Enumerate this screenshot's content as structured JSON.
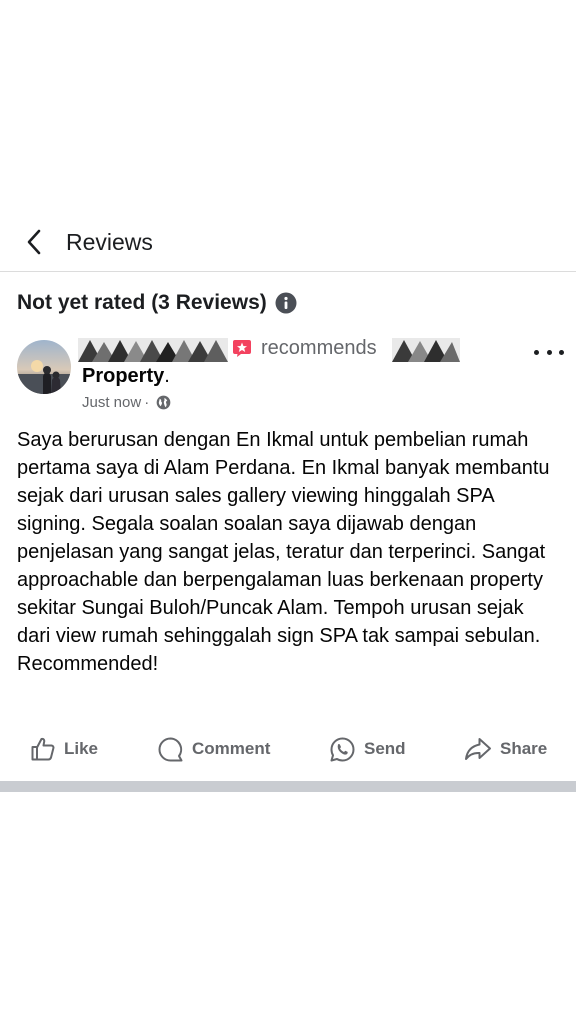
{
  "header": {
    "title": "Reviews",
    "back_icon": "chevron-left-icon"
  },
  "rating": {
    "text": "Not yet rated (3 Reviews)",
    "info_icon": "info-icon"
  },
  "post": {
    "recommends_label": "recommends",
    "page_name": "Property",
    "page_name_suffix": ".",
    "timestamp": "Just now",
    "separator": "·",
    "privacy_icon": "globe-icon",
    "badge_icon": "recommend-badge-icon",
    "badge_color": "#f3425f",
    "body": "Saya berurusan dengan En Ikmal untuk pembelian rumah pertama saya di Alam Perdana. En Ikmal banyak membantu sejak dari urusan sales gallery viewing hinggalah SPA signing. Segala soalan soalan saya dijawab dengan penjelasan yang sangat jelas, teratur dan terperinci. Sangat approachable dan berpengalaman luas berkenaan property sekitar Sungai Buloh/Puncak Alam. Tempoh urusan sejak dari view rumah sehinggalah sign SPA tak sampai sebulan. Recommended!"
  },
  "actions": {
    "like": "Like",
    "comment": "Comment",
    "send": "Send",
    "share": "Share"
  },
  "colors": {
    "secondary_text": "#65676b",
    "divider": "#c9ccd1"
  }
}
